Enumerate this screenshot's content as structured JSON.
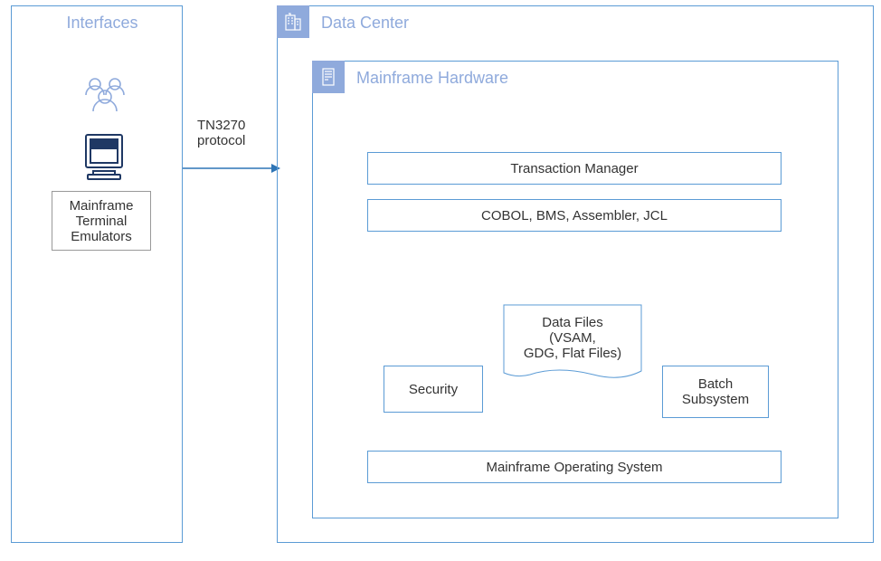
{
  "interfaces": {
    "title": "Interfaces",
    "emulators_label": "Mainframe\nTerminal\nEmulators"
  },
  "datacenter": {
    "title": "Data Center",
    "hardware": {
      "title": "Mainframe Hardware",
      "transaction_manager": "Transaction Manager",
      "languages": "COBOL, BMS, Assembler, JCL",
      "data_files": "Data Files\n(VSAM,\nGDG, Flat Files)",
      "security": "Security",
      "batch": "Batch\nSubsystem",
      "os": "Mainframe Operating System"
    }
  },
  "connection": {
    "protocol_label": "TN3270\nprotocol"
  }
}
